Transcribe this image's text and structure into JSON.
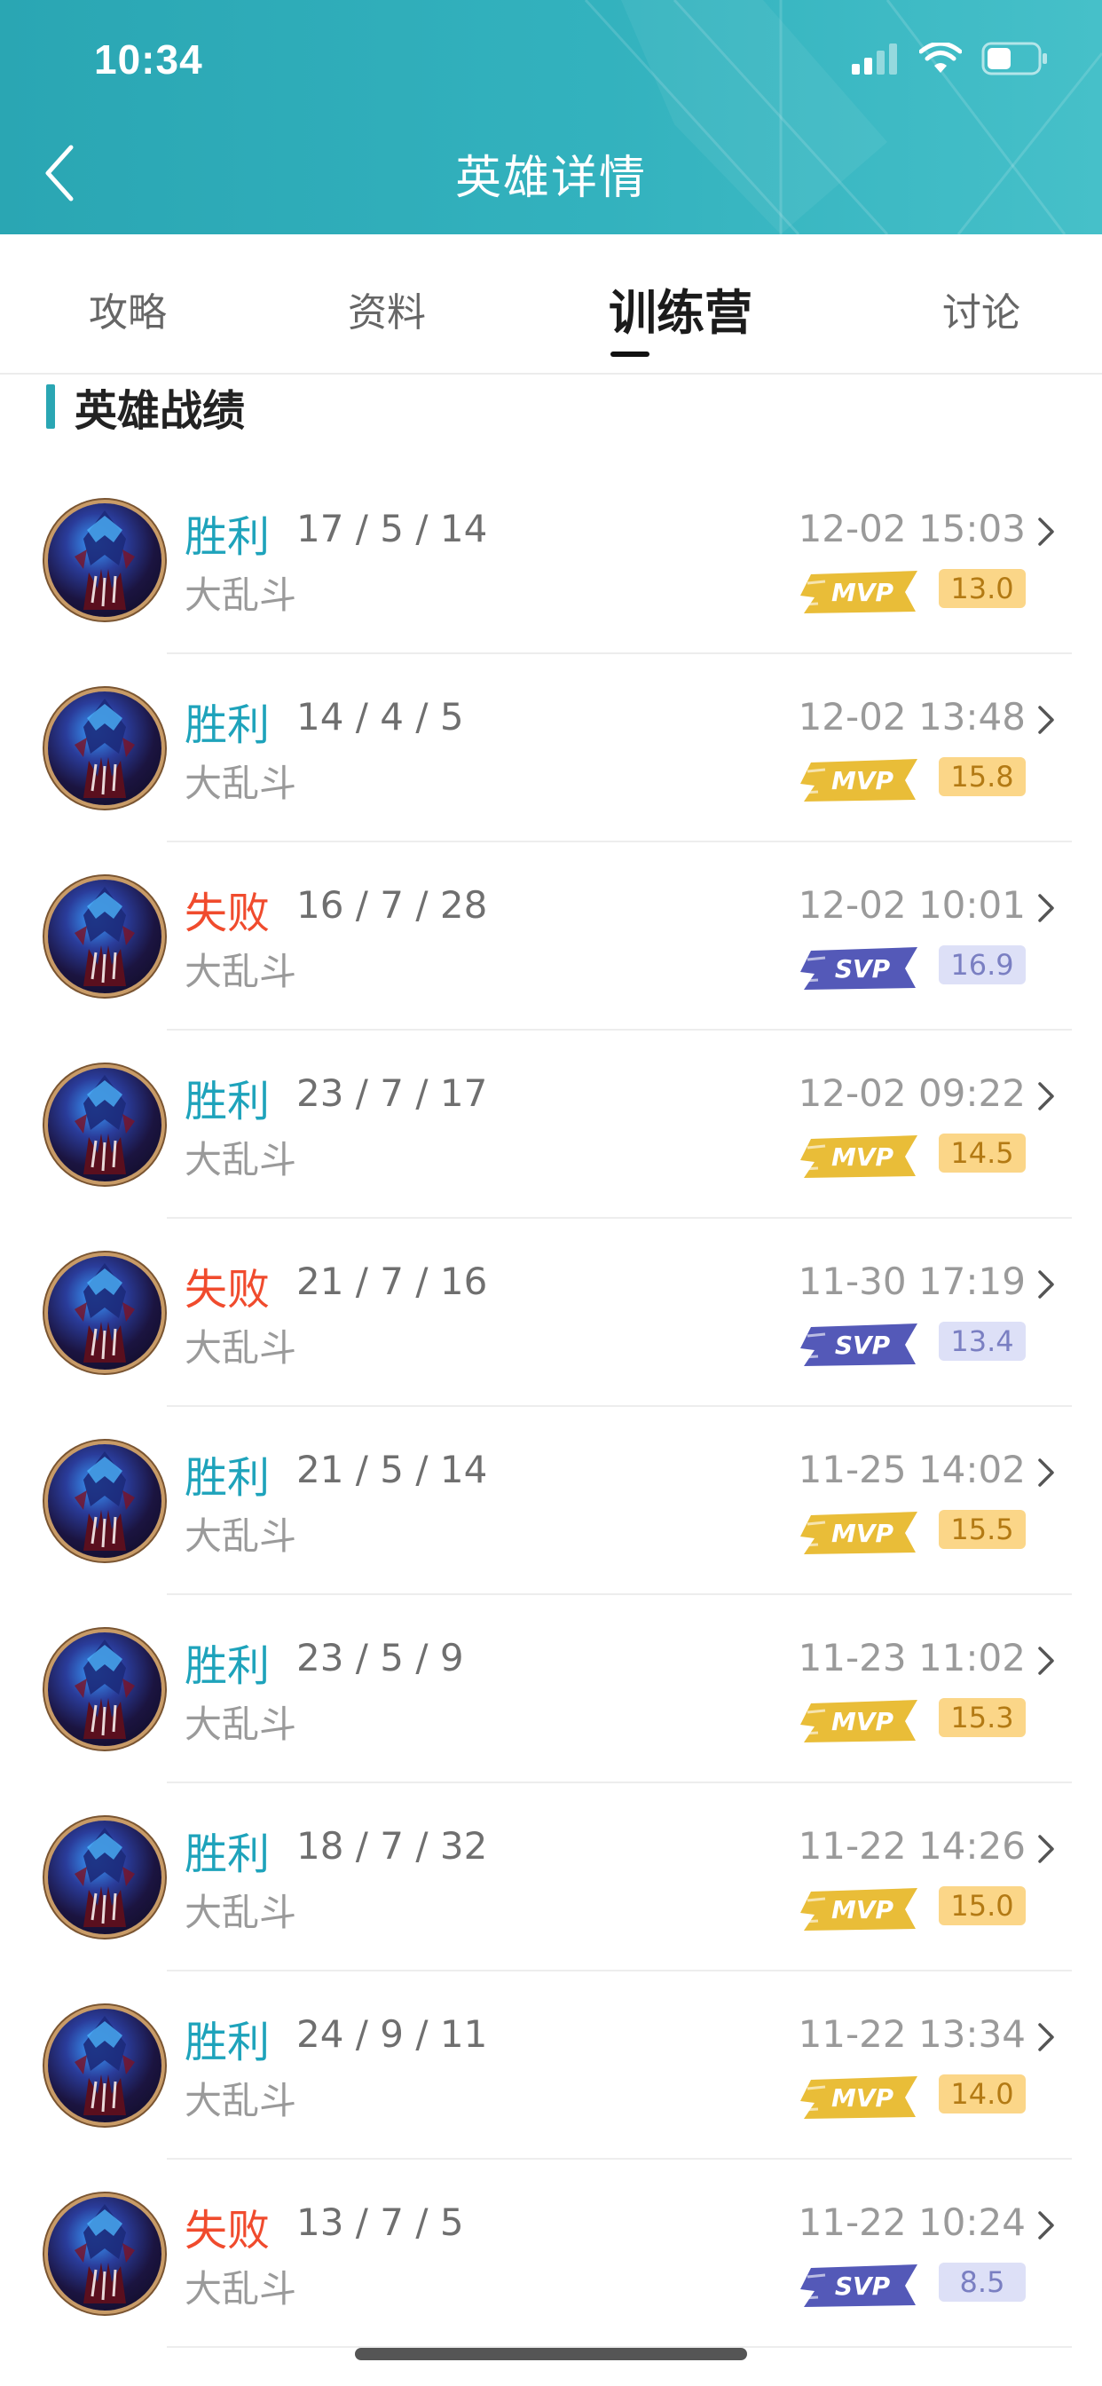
{
  "status_bar": {
    "time": "10:34"
  },
  "header": {
    "title": "英雄详情"
  },
  "tabs": [
    {
      "label": "攻略",
      "active": false
    },
    {
      "label": "资料",
      "active": false
    },
    {
      "label": "训练营",
      "active": true
    },
    {
      "label": "讨论",
      "active": false
    }
  ],
  "section": {
    "title": "英雄战绩"
  },
  "colors": {
    "accent": "#2aa6b3",
    "win": "#1ea3bb",
    "loss": "#f04b2d",
    "mvp_badge": "#fbd688",
    "svp_badge": "#dde0f7"
  },
  "matches": [
    {
      "result": "胜利",
      "outcome": "win",
      "kda": "17 / 5 / 14",
      "mode": "大乱斗",
      "time": "12-02 15:03",
      "medal": "MVP",
      "score": "13.0"
    },
    {
      "result": "胜利",
      "outcome": "win",
      "kda": "14 / 4 / 5",
      "mode": "大乱斗",
      "time": "12-02 13:48",
      "medal": "MVP",
      "score": "15.8"
    },
    {
      "result": "失败",
      "outcome": "loss",
      "kda": "16 / 7 / 28",
      "mode": "大乱斗",
      "time": "12-02 10:01",
      "medal": "SVP",
      "score": "16.9"
    },
    {
      "result": "胜利",
      "outcome": "win",
      "kda": "23 / 7 / 17",
      "mode": "大乱斗",
      "time": "12-02 09:22",
      "medal": "MVP",
      "score": "14.5"
    },
    {
      "result": "失败",
      "outcome": "loss",
      "kda": "21 / 7 / 16",
      "mode": "大乱斗",
      "time": "11-30 17:19",
      "medal": "SVP",
      "score": "13.4"
    },
    {
      "result": "胜利",
      "outcome": "win",
      "kda": "21 / 5 / 14",
      "mode": "大乱斗",
      "time": "11-25 14:02",
      "medal": "MVP",
      "score": "15.5"
    },
    {
      "result": "胜利",
      "outcome": "win",
      "kda": "23 / 5 / 9",
      "mode": "大乱斗",
      "time": "11-23 11:02",
      "medal": "MVP",
      "score": "15.3"
    },
    {
      "result": "胜利",
      "outcome": "win",
      "kda": "18 / 7 / 32",
      "mode": "大乱斗",
      "time": "11-22 14:26",
      "medal": "MVP",
      "score": "15.0"
    },
    {
      "result": "胜利",
      "outcome": "win",
      "kda": "24 / 9 / 11",
      "mode": "大乱斗",
      "time": "11-22 13:34",
      "medal": "MVP",
      "score": "14.0"
    },
    {
      "result": "失败",
      "outcome": "loss",
      "kda": "13 / 7 / 5",
      "mode": "大乱斗",
      "time": "11-22 10:24",
      "medal": "SVP",
      "score": "8.5"
    }
  ]
}
